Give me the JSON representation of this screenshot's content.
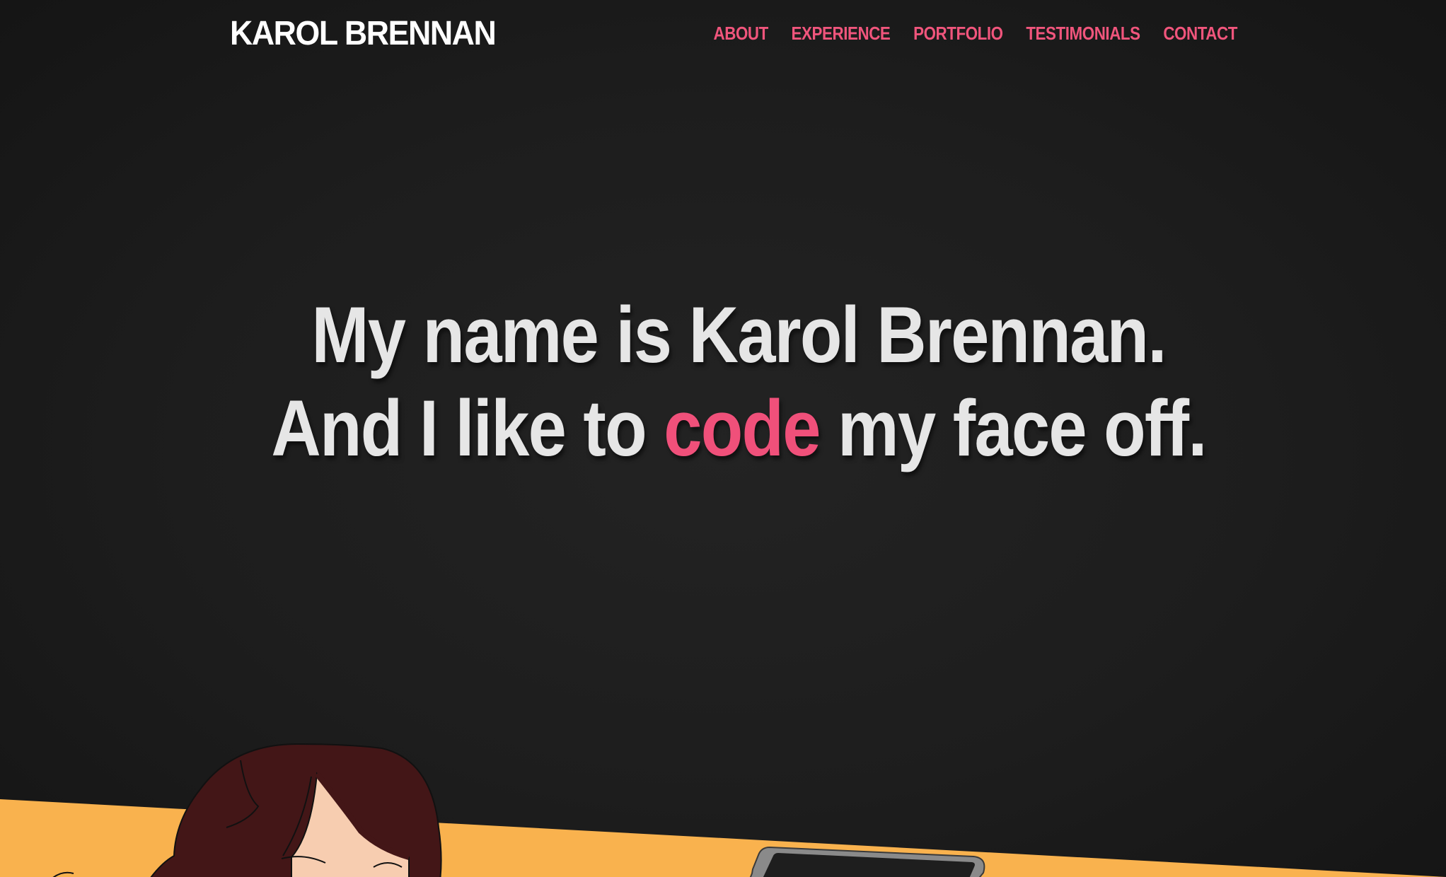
{
  "header": {
    "logo": "KAROL BRENNAN",
    "nav": [
      {
        "label": "ABOUT"
      },
      {
        "label": "EXPERIENCE"
      },
      {
        "label": "PORTFOLIO"
      },
      {
        "label": "TESTIMONIALS"
      },
      {
        "label": "CONTACT"
      }
    ]
  },
  "hero": {
    "line1": "My name is Karol Brennan.",
    "line2_before": "And I like to ",
    "line2_accent": "code",
    "line2_after": " my face off."
  },
  "colors": {
    "background": "#1c1c1c",
    "accent": "#f0557c",
    "hero_text": "#e6e6e6",
    "desk": "#f9b24e",
    "hair": "#431617",
    "skin": "#f7cdb0",
    "laptop_frame": "#8a8a8a",
    "laptop_screen": "#1e1e1e"
  },
  "illustration": {
    "icons": [
      "person-illustration",
      "laptop-illustration",
      "desk-illustration"
    ]
  }
}
